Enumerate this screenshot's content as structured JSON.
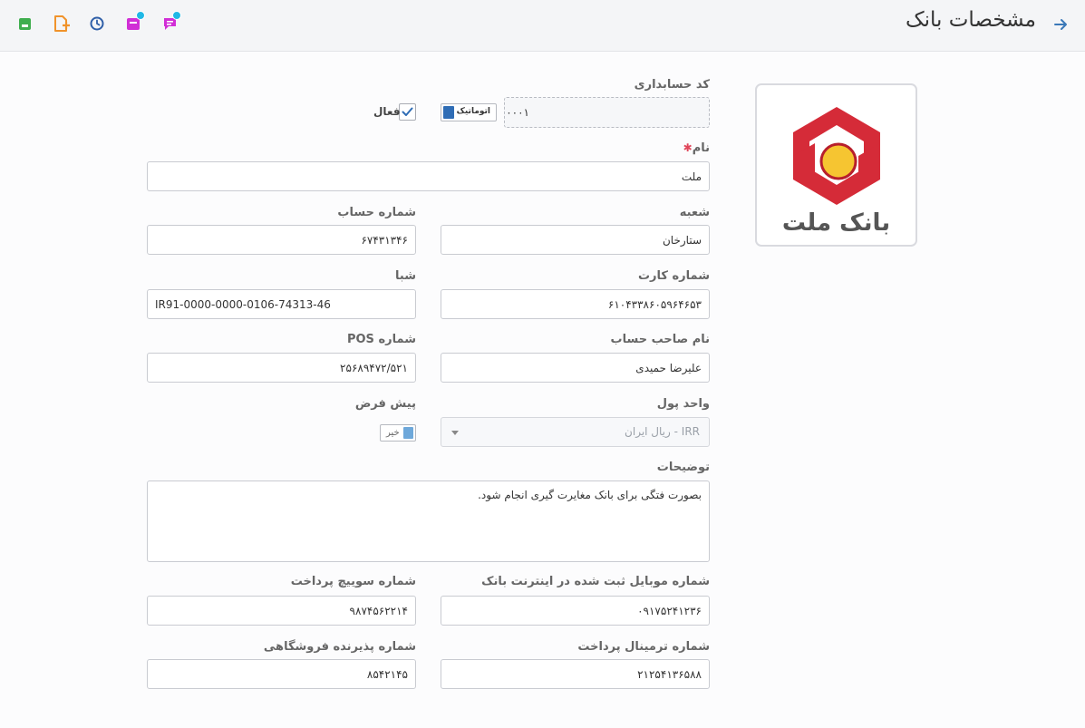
{
  "header": {
    "title": "مشخصات بانک",
    "icons": [
      "back-arrow-icon",
      "chat-icon",
      "inbox-icon",
      "clock-icon",
      "add-document-icon",
      "save-icon"
    ]
  },
  "form": {
    "accounting_code": {
      "label": "کد حسابداری",
      "value": "۰۰۰۱",
      "auto_label": "اتوماتیک"
    },
    "active": {
      "label": "فعال",
      "checked": true
    },
    "name": {
      "label": "نام",
      "required_mark": "✱",
      "value": "ملت"
    },
    "branch": {
      "label": "شعبه",
      "value": "ستارخان"
    },
    "account_number": {
      "label": "شماره حساب",
      "value": "۶۷۴۳۱۳۴۶"
    },
    "card_number": {
      "label": "شماره کارت",
      "value": "۶۱۰۴۳۳۸۶۰۵۹۶۴۶۵۳"
    },
    "sheba": {
      "label": "شبا",
      "value": "IR91-0000-0000-0106-74313-46"
    },
    "holder_name": {
      "label": "نام صاحب حساب",
      "value": "علیرضا حمیدی"
    },
    "pos_number": {
      "label": "شماره POS",
      "value": "۲۵۶۸۹۴۷۲/۵۲۱"
    },
    "currency": {
      "label": "واحد پول",
      "value": "IRR - ریال ایران"
    },
    "default": {
      "label": "پیش فرض",
      "value": "خیر"
    },
    "description": {
      "label": "توضیحات",
      "value": "بصورت فتگی برای بانک مغایرت گیری انجام شود."
    },
    "mobile": {
      "label": "شماره موبایل ثبت شده در اینترنت بانک",
      "value": "۰۹۱۷۵۲۴۱۲۳۶"
    },
    "switch_number": {
      "label": "شماره سوییچ پرداخت",
      "value": "۹۸۷۴۵۶۲۲۱۴"
    },
    "terminal": {
      "label": "شماره ترمینال پرداخت",
      "value": "۲۱۲۵۴۱۳۶۵۸۸"
    },
    "merchant": {
      "label": "شماره پذیرنده فروشگاهی",
      "value": "۸۵۴۲۱۴۵"
    }
  },
  "logo": {
    "text": "بانک ملت"
  },
  "colors": {
    "logo_red": "#d52b38",
    "logo_yellow": "#f6c531",
    "badge": "#1fb8e6",
    "required": "#e0465a"
  }
}
